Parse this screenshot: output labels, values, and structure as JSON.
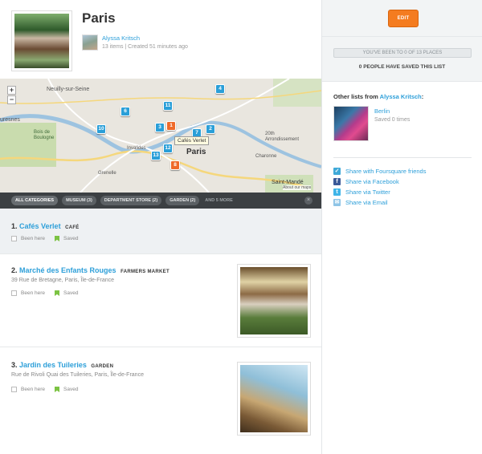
{
  "list": {
    "title": "Paris",
    "author": "Alyssa Kritsch",
    "meta": "13 items | Created 51 minutes ago"
  },
  "map": {
    "zoom_in": "+",
    "zoom_out": "−",
    "labels": [
      "Neuilly-sur-Seine",
      "uresnes",
      "Bois de Boulogne",
      "Paris",
      "Invalides",
      "Grenelle",
      "Charonne",
      "20th Arrondissement",
      "Saint-Mandé",
      "About our maps"
    ],
    "pins": [
      "4",
      "11",
      "6",
      "10",
      "3",
      "1",
      "7",
      "2",
      "12",
      "13",
      "8"
    ],
    "tooltip": "Cafés Verlet"
  },
  "filters": {
    "chips": [
      "ALL CATEGORIES",
      "MUSEUM (3)",
      "DEPARTMENT STORE (2)",
      "GARDEN (2)"
    ],
    "more": "AND 5 MORE",
    "close": "×"
  },
  "items": [
    {
      "index": "1.",
      "name": "Cafés Verlet",
      "category": "CAFÉ",
      "address": "",
      "been_here": "Been here",
      "saved": "Saved"
    },
    {
      "index": "2.",
      "name": "Marché des Enfants Rouges",
      "category": "FARMERS MARKET",
      "address": "39 Rue de Bretagne, Paris, Île-de-France",
      "been_here": "Been here",
      "saved": "Saved"
    },
    {
      "index": "3.",
      "name": "Jardin des Tuileries",
      "category": "GARDEN",
      "address": "Rue de Rivoli Quai des Tuileries, Paris, Île-de-France",
      "been_here": "Been here",
      "saved": "Saved"
    }
  ],
  "sidebar": {
    "edit_label": "EDIT",
    "progress_text": "YOU'VE BEEN TO 0 OF 13 PLACES",
    "saved_text": "0 PEOPLE HAVE SAVED THIS LIST",
    "other_lists_prefix": "Other lists from",
    "other_lists_author": "Alyssa Kritsch",
    "other_lists_suffix": ":",
    "other_list_name": "Berlin",
    "other_list_saved": "Saved 0 times",
    "share": [
      {
        "label": "Share with Foursquare friends",
        "icon": "foursquare-icon",
        "color": "#3fa9d8"
      },
      {
        "label": "Share via Facebook",
        "icon": "facebook-icon",
        "color": "#3b5998"
      },
      {
        "label": "Share via Twitter",
        "icon": "twitter-icon",
        "color": "#3fb5e8"
      },
      {
        "label": "Share via Email",
        "icon": "email-icon",
        "color": "#8ec4e6"
      }
    ]
  },
  "colors": {
    "accent": "#2d9fd9",
    "edit": "#f47c20",
    "saved": "#7cc343",
    "pin": "#2a9fd8",
    "pin_active": "#ef6a2a"
  }
}
